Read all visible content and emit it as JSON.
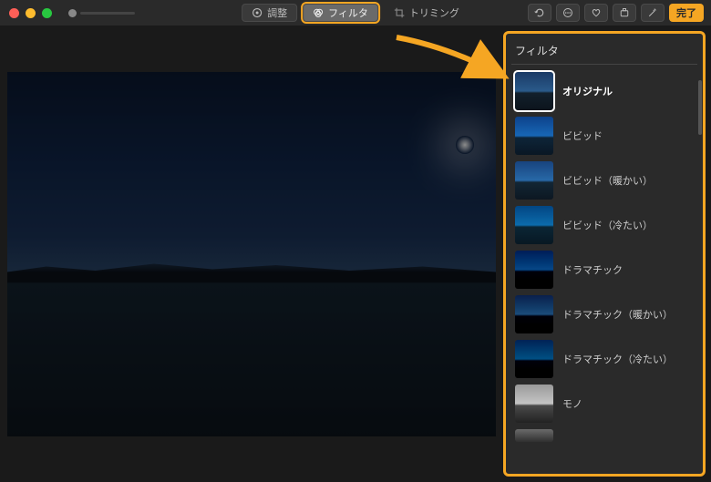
{
  "toolbar": {
    "adjust_label": "調整",
    "filter_label": "フィルタ",
    "crop_label": "トリミング",
    "done_label": "完了"
  },
  "sidebar": {
    "title": "フィルタ",
    "filters": [
      {
        "label": "オリジナル"
      },
      {
        "label": "ビビッド"
      },
      {
        "label": "ビビッド（暖かい）"
      },
      {
        "label": "ビビッド（冷たい）"
      },
      {
        "label": "ドラマチック"
      },
      {
        "label": "ドラマチック（暖かい）"
      },
      {
        "label": "ドラマチック（冷たい）"
      },
      {
        "label": "モノ"
      }
    ]
  }
}
